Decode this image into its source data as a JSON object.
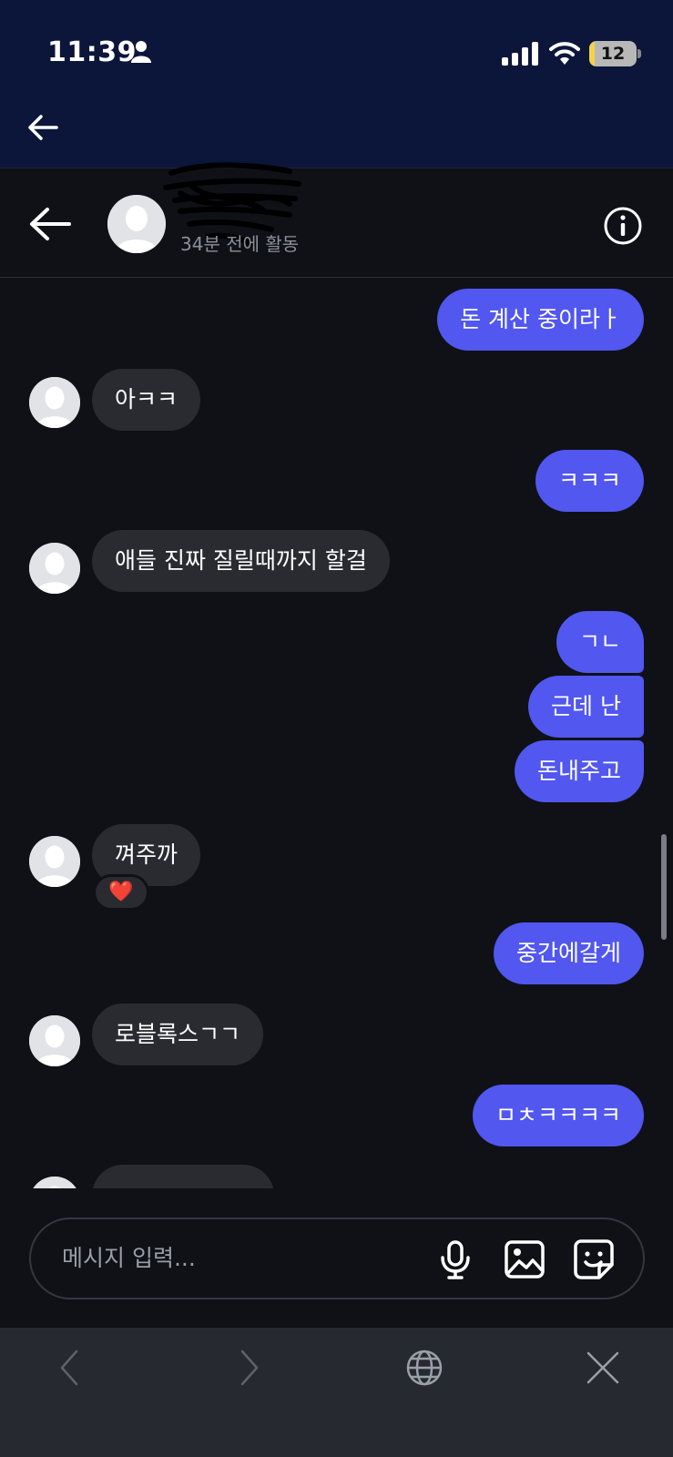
{
  "status_bar": {
    "time": "11:39",
    "battery": "12"
  },
  "colors": {
    "accent": "#5157ef",
    "incoming": "#2a2b30",
    "background": "#0f1117",
    "status_bar_bg": "#0b163a"
  },
  "chat": {
    "contact_status": "34분 전에 활동"
  },
  "messages": [
    {
      "side": "me",
      "text": "돈 계산 중이라ㅏ"
    },
    {
      "side": "them",
      "text": "아ㅋㅋ"
    },
    {
      "side": "me",
      "text": "ㅋㅋㅋ"
    },
    {
      "side": "them",
      "text": "애들 진짜 질릴때까지 할걸"
    },
    {
      "side": "me",
      "text": "ㄱㄴ"
    },
    {
      "side": "me",
      "text": "근데 난"
    },
    {
      "side": "me",
      "text": "돈내주고"
    },
    {
      "side": "them",
      "text": "껴주까",
      "reaction": "❤️"
    },
    {
      "side": "me",
      "text": "중간에갈게"
    },
    {
      "side": "them",
      "text": "로블록스ㄱㄱ"
    },
    {
      "side": "me",
      "text": "ㅁㅊㅋㅋㅋㅋ"
    },
    {
      "side": "them",
      "text": ""
    }
  ],
  "input": {
    "placeholder": "메시지 입력..."
  },
  "icons": {
    "top_back": "arrow-left-icon",
    "header_back": "arrow-left-icon",
    "info": "info-icon",
    "mic": "microphone-icon",
    "image": "image-icon",
    "sticker": "sticker-icon",
    "browser_back": "chevron-left-icon",
    "browser_forward": "chevron-right-icon",
    "browser_globe": "globe-icon",
    "browser_close": "close-icon"
  }
}
